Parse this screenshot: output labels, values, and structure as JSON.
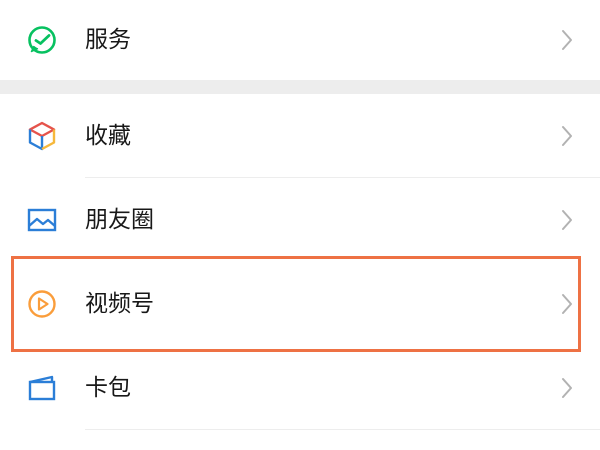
{
  "menu": {
    "items": [
      {
        "label": "服务",
        "icon": "wechat-pay-icon"
      },
      {
        "label": "收藏",
        "icon": "favorites-cube-icon"
      },
      {
        "label": "朋友圈",
        "icon": "moments-picture-icon"
      },
      {
        "label": "视频号",
        "icon": "channels-play-icon",
        "highlighted": true
      },
      {
        "label": "卡包",
        "icon": "cards-wallet-icon"
      }
    ]
  },
  "colors": {
    "background": "#ffffff",
    "section_gap": "#ededed",
    "text": "#181818",
    "chevron": "#b2b2b2",
    "highlight_border": "#ee7144",
    "service_green": "#07c160",
    "channels_orange": "#fa9d3b",
    "moments_blue": "#2b7ed7",
    "cards_blue": "#2b7ed7"
  }
}
